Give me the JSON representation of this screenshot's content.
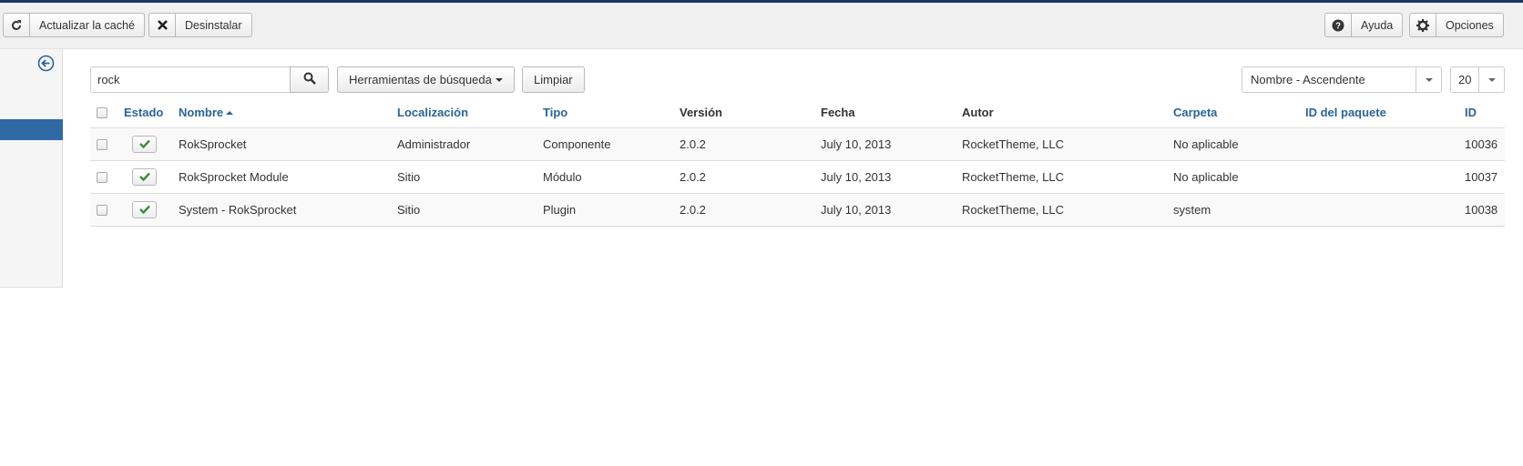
{
  "toolbar": {
    "refresh_label": "Actualizar la caché",
    "uninstall_label": "Desinstalar",
    "help_label": "Ayuda",
    "options_label": "Opciones"
  },
  "filters": {
    "search_value": "rock",
    "search_tools_label": "Herramientas de búsqueda",
    "clear_label": "Limpiar",
    "ordering_selected": "Nombre - Ascendente",
    "limit_selected": "20"
  },
  "table": {
    "headers": {
      "status": "Estado",
      "name": "Nombre",
      "location": "Localización",
      "type": "Tipo",
      "version": "Versión",
      "date": "Fecha",
      "author": "Autor",
      "folder": "Carpeta",
      "package_id": "ID del paquete",
      "id": "ID"
    },
    "rows": [
      {
        "name": "RokSprocket",
        "location": "Administrador",
        "type": "Componente",
        "version": "2.0.2",
        "date": "July 10, 2013",
        "author": "RocketTheme, LLC",
        "folder": "No aplicable",
        "package_id": "",
        "id": "10036"
      },
      {
        "name": "RokSprocket Module",
        "location": "Sitio",
        "type": "Módulo",
        "version": "2.0.2",
        "date": "July 10, 2013",
        "author": "RocketTheme, LLC",
        "folder": "No aplicable",
        "package_id": "",
        "id": "10037"
      },
      {
        "name": "System - RokSprocket",
        "location": "Sitio",
        "type": "Plugin",
        "version": "2.0.2",
        "date": "July 10, 2013",
        "author": "RocketTheme, LLC",
        "folder": "system",
        "package_id": "",
        "id": "10038"
      }
    ]
  },
  "icons": {
    "refresh": "refresh-icon",
    "uninstall": "close-icon",
    "help": "question-icon",
    "options": "gear-icon",
    "sidebar_toggle": "arrow-left-circle-icon",
    "search": "search-icon",
    "status": "check-icon"
  },
  "colors": {
    "topline": "#1a3867",
    "link": "#2a6496",
    "sidebar_active": "#2f6aa4",
    "status_check": "#3c8c3c"
  }
}
